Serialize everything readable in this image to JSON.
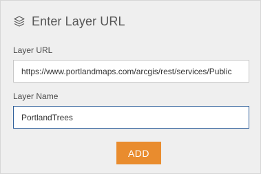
{
  "header": {
    "icon": "layers-icon",
    "title": "Enter Layer URL"
  },
  "layer_url": {
    "label": "Layer URL",
    "value": "https://www.portlandmaps.com/arcgis/rest/services/Public"
  },
  "layer_name": {
    "label": "Layer Name",
    "value": "PortlandTrees"
  },
  "actions": {
    "add_label": "ADD"
  },
  "colors": {
    "panel_background": "#efefef",
    "accent_button": "#e98c2e",
    "focused_border": "#2f5f9a"
  }
}
